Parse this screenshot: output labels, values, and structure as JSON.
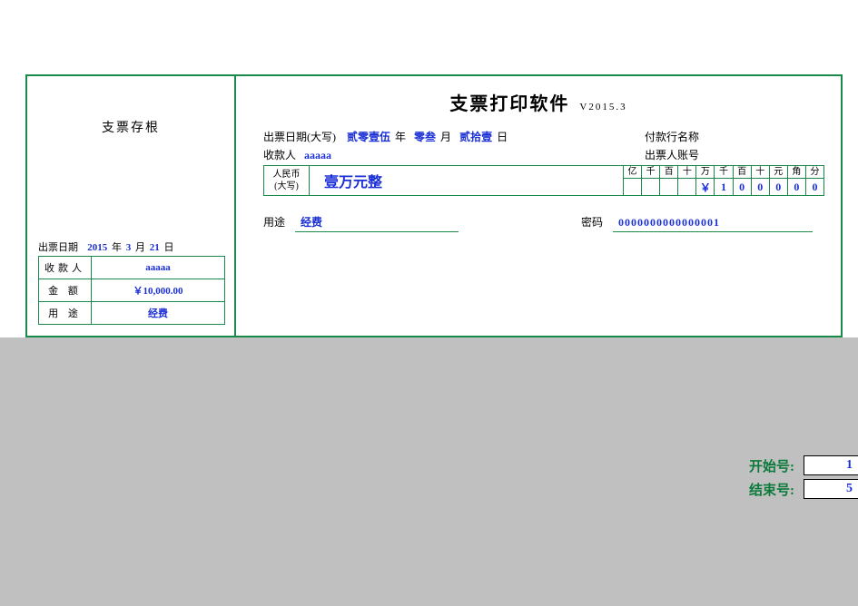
{
  "stub": {
    "title": "支票存根",
    "date_label": "出票日期",
    "date": {
      "year": "2015",
      "month": "3",
      "day": "21"
    },
    "date_units": {
      "y": "年",
      "m": "月",
      "d": "日"
    },
    "rows": {
      "payee": {
        "label": "收款人",
        "value": "aaaaa"
      },
      "amount": {
        "label": "金  额",
        "value": "￥10,000.00"
      },
      "purpose": {
        "label": "用  途",
        "value": "经费"
      }
    }
  },
  "main": {
    "title": "支票打印软件",
    "version": "V2015.3",
    "date_label": "出票日期(大写)",
    "date_words": {
      "year": "贰零壹伍",
      "month": "零叁",
      "day": "贰拾壹"
    },
    "date_units": {
      "y": "年",
      "m": "月",
      "d": "日"
    },
    "pay_bank_label": "付款行名称",
    "payee_label": "收款人",
    "payee": "aaaaa",
    "account_label": "出票人账号",
    "amount_label_1": "人民币",
    "amount_label_2": "(大写)",
    "amount_words": "壹万元整",
    "digit_headers": [
      "亿",
      "千",
      "百",
      "十",
      "万",
      "千",
      "百",
      "十",
      "元",
      "角",
      "分"
    ],
    "digit_values": [
      "",
      "",
      "",
      "",
      "￥",
      "1",
      "0",
      "0",
      "0",
      "0",
      "0"
    ],
    "purpose_label": "用途",
    "purpose": "经费",
    "password_label": "密码",
    "password": "0000000000000001"
  },
  "footer": {
    "start_label": "开始号:",
    "start_value": "1",
    "end_label": "结束号:",
    "end_value": "5"
  }
}
